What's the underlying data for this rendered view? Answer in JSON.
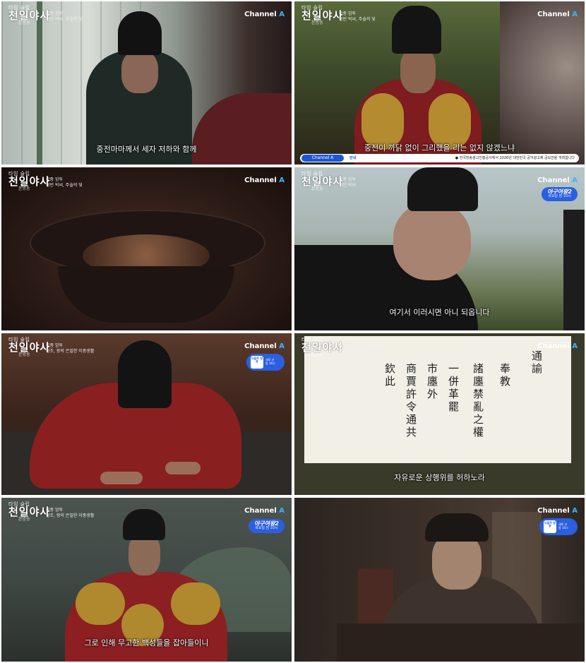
{
  "logo": {
    "small": "타임 슬립",
    "big": "천일야사",
    "tiny": "본방송"
  },
  "channel": {
    "name": "Channel",
    "mark": "A"
  },
  "panels": [
    {
      "episode": "궁중 암투\n정빈 박씨, 주술의 덫",
      "subtitle": "중전마마께서 세자 저하와 함께"
    },
    {
      "episode": "궁중 암투\n정빈 박씨, 주술의 덫",
      "subtitle": "중전이 까닭 없이 그리했을 리는 없지 않겠느냐",
      "ticker": {
        "tag": "Channel A",
        "label": "안내",
        "text": "● 한국방송광고진흥공사에서 2026년 대한민국 공익광고제 공모전을 개최합니다"
      }
    },
    {
      "episode": "궁중 암투\n정빈 박씨, 주술의 덫",
      "subtitle": ""
    },
    {
      "episode": "궁중 암투\n정빈 박씨",
      "subtitle": "여기서 이러시면 아니 되옵니다",
      "promo": {
        "title": "야구여왕2",
        "time": "목요일 밤 10시"
      }
    },
    {
      "episode": "궁중 암투\n정조, 왕의 은밀한 이중생활",
      "subtitle": "",
      "promo2": {
        "badge": "다음주 방송",
        "text": "새로 산 \n밤 10시"
      }
    },
    {
      "episode": "궁중 암투\n정조, 왕의 은밀한 이중생활",
      "subtitle": "자유로운 상행위를 허하노라",
      "document": [
        "通諭",
        "奉教",
        "諸廛禁亂之權",
        "一併革罷",
        "市廛外",
        "商賈許令通共",
        "欽此"
      ]
    },
    {
      "episode": "궁중 암투\n정조, 왕의 은밀한 이중생활",
      "subtitle": "그로 인해 무고한 백성들을 잡아들이니",
      "promo": {
        "title": "야구여왕2",
        "time": "목요일 밤 10시"
      }
    },
    {
      "episode": "",
      "subtitle": "",
      "promo2": {
        "badge": "다음주 방송",
        "text": "새로 산 \n밤 10시"
      }
    }
  ]
}
